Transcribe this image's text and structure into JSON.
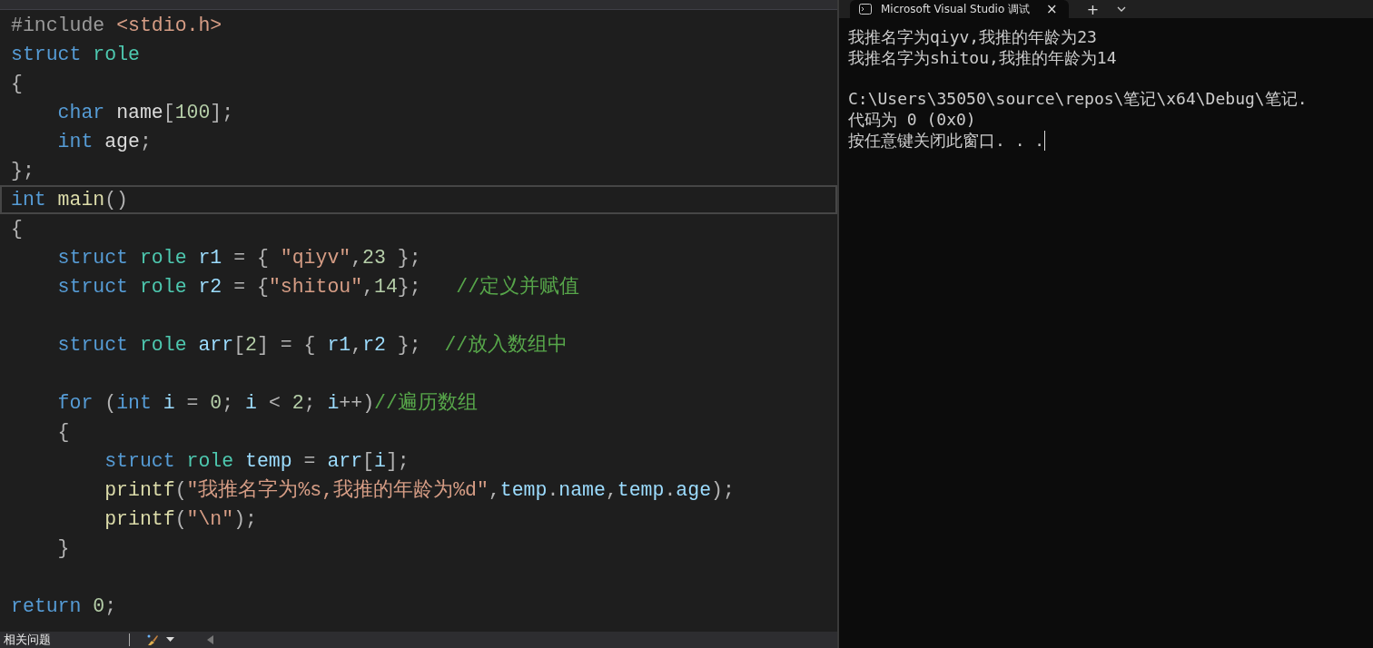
{
  "editor": {
    "lines": [
      {
        "current": false,
        "tokens": [
          {
            "kind": "macro",
            "text": "#include "
          },
          {
            "kind": "str",
            "text": "<stdio.h>"
          }
        ]
      },
      {
        "current": false,
        "tokens": [
          {
            "kind": "kw",
            "text": "struct "
          },
          {
            "kind": "type",
            "text": "role"
          }
        ]
      },
      {
        "current": false,
        "tokens": [
          {
            "kind": "punct",
            "text": "{"
          }
        ]
      },
      {
        "current": false,
        "tokens": [
          {
            "kind": "kw",
            "text": "    char "
          },
          {
            "kind": "plain",
            "text": "name"
          },
          {
            "kind": "punct",
            "text": "["
          },
          {
            "kind": "num",
            "text": "100"
          },
          {
            "kind": "punct",
            "text": "];"
          }
        ]
      },
      {
        "current": false,
        "tokens": [
          {
            "kind": "kw",
            "text": "    int "
          },
          {
            "kind": "plain",
            "text": "age"
          },
          {
            "kind": "punct",
            "text": ";"
          }
        ]
      },
      {
        "current": false,
        "tokens": [
          {
            "kind": "punct",
            "text": "};"
          }
        ]
      },
      {
        "current": true,
        "tokens": [
          {
            "kind": "kw",
            "text": "int "
          },
          {
            "kind": "fn",
            "text": "main"
          },
          {
            "kind": "punct",
            "text": "()"
          }
        ]
      },
      {
        "current": false,
        "tokens": [
          {
            "kind": "punct",
            "text": "{"
          }
        ]
      },
      {
        "current": false,
        "tokens": [
          {
            "kind": "kw",
            "text": "    struct "
          },
          {
            "kind": "type",
            "text": "role "
          },
          {
            "kind": "var",
            "text": "r1 "
          },
          {
            "kind": "punct",
            "text": "= { "
          },
          {
            "kind": "str",
            "text": "\"qiyv\""
          },
          {
            "kind": "punct",
            "text": ","
          },
          {
            "kind": "num",
            "text": "23"
          },
          {
            "kind": "punct",
            "text": " };"
          }
        ]
      },
      {
        "current": false,
        "tokens": [
          {
            "kind": "kw",
            "text": "    struct "
          },
          {
            "kind": "type",
            "text": "role "
          },
          {
            "kind": "var",
            "text": "r2 "
          },
          {
            "kind": "punct",
            "text": "= {"
          },
          {
            "kind": "str",
            "text": "\"shitou\""
          },
          {
            "kind": "punct",
            "text": ","
          },
          {
            "kind": "num",
            "text": "14"
          },
          {
            "kind": "punct",
            "text": "};   "
          },
          {
            "kind": "cmt",
            "text": "//定义并赋值"
          }
        ]
      },
      {
        "current": false
      },
      {
        "current": false,
        "tokens": [
          {
            "kind": "kw",
            "text": "    struct "
          },
          {
            "kind": "type",
            "text": "role "
          },
          {
            "kind": "var",
            "text": "arr"
          },
          {
            "kind": "punct",
            "text": "["
          },
          {
            "kind": "num",
            "text": "2"
          },
          {
            "kind": "punct",
            "text": "] = { "
          },
          {
            "kind": "var",
            "text": "r1"
          },
          {
            "kind": "punct",
            "text": ","
          },
          {
            "kind": "var",
            "text": "r2"
          },
          {
            "kind": "punct",
            "text": " };  "
          },
          {
            "kind": "cmt",
            "text": "//放入数组中"
          }
        ]
      },
      {
        "current": false
      },
      {
        "current": false,
        "tokens": [
          {
            "kind": "kw",
            "text": "    for "
          },
          {
            "kind": "punct",
            "text": "("
          },
          {
            "kind": "kw",
            "text": "int "
          },
          {
            "kind": "var",
            "text": "i "
          },
          {
            "kind": "punct",
            "text": "= "
          },
          {
            "kind": "num",
            "text": "0"
          },
          {
            "kind": "punct",
            "text": "; "
          },
          {
            "kind": "var",
            "text": "i "
          },
          {
            "kind": "punct",
            "text": "< "
          },
          {
            "kind": "num",
            "text": "2"
          },
          {
            "kind": "punct",
            "text": "; "
          },
          {
            "kind": "var",
            "text": "i"
          },
          {
            "kind": "punct",
            "text": "++)"
          },
          {
            "kind": "cmt",
            "text": "//遍历数组"
          }
        ]
      },
      {
        "current": false,
        "tokens": [
          {
            "kind": "punct",
            "text": "    {"
          }
        ]
      },
      {
        "current": false,
        "tokens": [
          {
            "kind": "kw",
            "text": "        struct "
          },
          {
            "kind": "type",
            "text": "role "
          },
          {
            "kind": "var",
            "text": "temp "
          },
          {
            "kind": "punct",
            "text": "= "
          },
          {
            "kind": "var",
            "text": "arr"
          },
          {
            "kind": "punct",
            "text": "["
          },
          {
            "kind": "var",
            "text": "i"
          },
          {
            "kind": "punct",
            "text": "];"
          }
        ]
      },
      {
        "current": false,
        "tokens": [
          {
            "kind": "fn",
            "text": "        printf"
          },
          {
            "kind": "punct",
            "text": "("
          },
          {
            "kind": "str",
            "text": "\"我推名字为%s,我推的年龄为%d\""
          },
          {
            "kind": "punct",
            "text": ","
          },
          {
            "kind": "var",
            "text": "temp"
          },
          {
            "kind": "punct",
            "text": "."
          },
          {
            "kind": "var",
            "text": "name"
          },
          {
            "kind": "punct",
            "text": ","
          },
          {
            "kind": "var",
            "text": "temp"
          },
          {
            "kind": "punct",
            "text": "."
          },
          {
            "kind": "var",
            "text": "age"
          },
          {
            "kind": "punct",
            "text": ");"
          }
        ]
      },
      {
        "current": false,
        "tokens": [
          {
            "kind": "fn",
            "text": "        printf"
          },
          {
            "kind": "punct",
            "text": "("
          },
          {
            "kind": "str",
            "text": "\"\\n\""
          },
          {
            "kind": "punct",
            "text": ");"
          }
        ]
      },
      {
        "current": false,
        "tokens": [
          {
            "kind": "punct",
            "text": "    }"
          }
        ]
      },
      {
        "current": false
      },
      {
        "current": false,
        "tokens": [
          {
            "kind": "kw",
            "text": "return "
          },
          {
            "kind": "num",
            "text": "0"
          },
          {
            "kind": "punct",
            "text": ";"
          }
        ]
      }
    ]
  },
  "status_bar": {
    "issues_label": "相关问题"
  },
  "terminal": {
    "tab_title": "Microsoft Visual Studio 调试",
    "close": "×",
    "new_tab": "+",
    "output": [
      "我推名字为qiyv,我推的年龄为23",
      "我推名字为shitou,我推的年龄为14"
    ],
    "exit_lines": [
      "C:\\Users\\35050\\source\\repos\\笔记\\x64\\Debug\\笔记.",
      "代码为 0 (0x0)",
      "按任意键关闭此窗口. . ."
    ]
  }
}
